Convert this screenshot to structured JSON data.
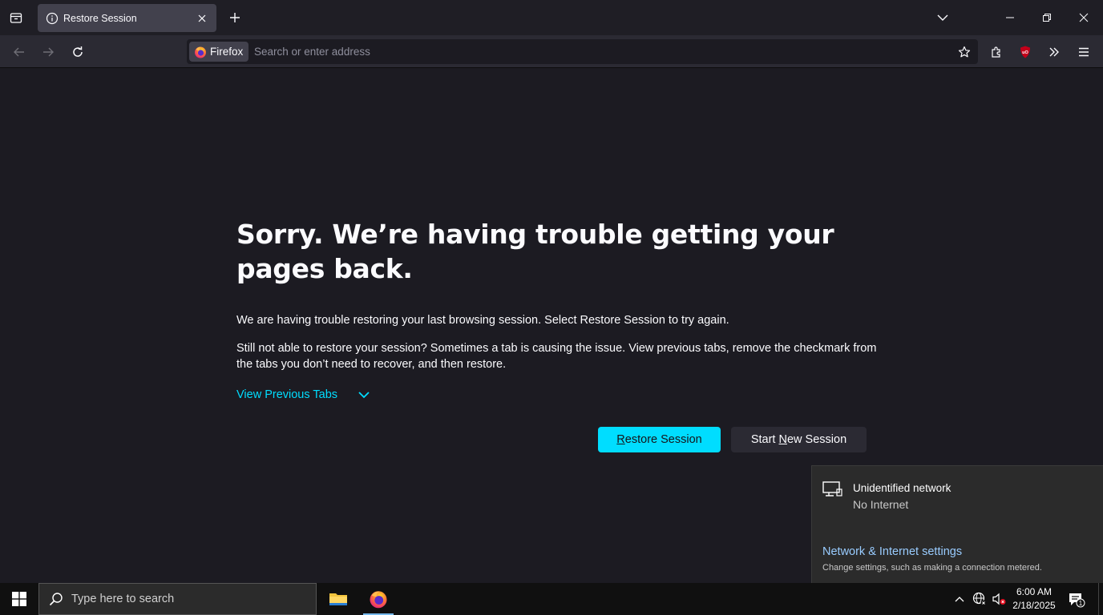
{
  "tabstrip": {
    "tab_title": "Restore Session"
  },
  "navbar": {
    "identity_label": "Firefox",
    "url_placeholder": "Search or enter address",
    "extension_badge": "uO"
  },
  "page": {
    "title": "Sorry. We’re having trouble getting your pages back.",
    "paragraph1": "We are having trouble restoring your last browsing session. Select Restore Session to try again.",
    "paragraph2": "Still not able to restore your session? Sometimes a tab is causing the issue. View previous tabs, remove the checkmark from the tabs you don’t need to recover, and then restore.",
    "view_previous_tabs": "View Previous Tabs",
    "restore_button": {
      "accesskey": "R",
      "rest": "estore Session"
    },
    "new_session_button": {
      "pre": "Start ",
      "accesskey": "N",
      "rest": "ew Session"
    }
  },
  "network_flyout": {
    "network_name": "Unidentified network",
    "status": "No Internet",
    "settings_link": "Network & Internet settings",
    "settings_desc": "Change settings, such as making a connection metered."
  },
  "taskbar": {
    "search_placeholder": "Type here to search",
    "time": "6:00 AM",
    "date": "2/18/2025",
    "notification_count": "1"
  },
  "colors": {
    "accent": "#00ddff",
    "background": "#1c1b22",
    "toolbar": "#2b2a33",
    "link": "#99ccff"
  }
}
